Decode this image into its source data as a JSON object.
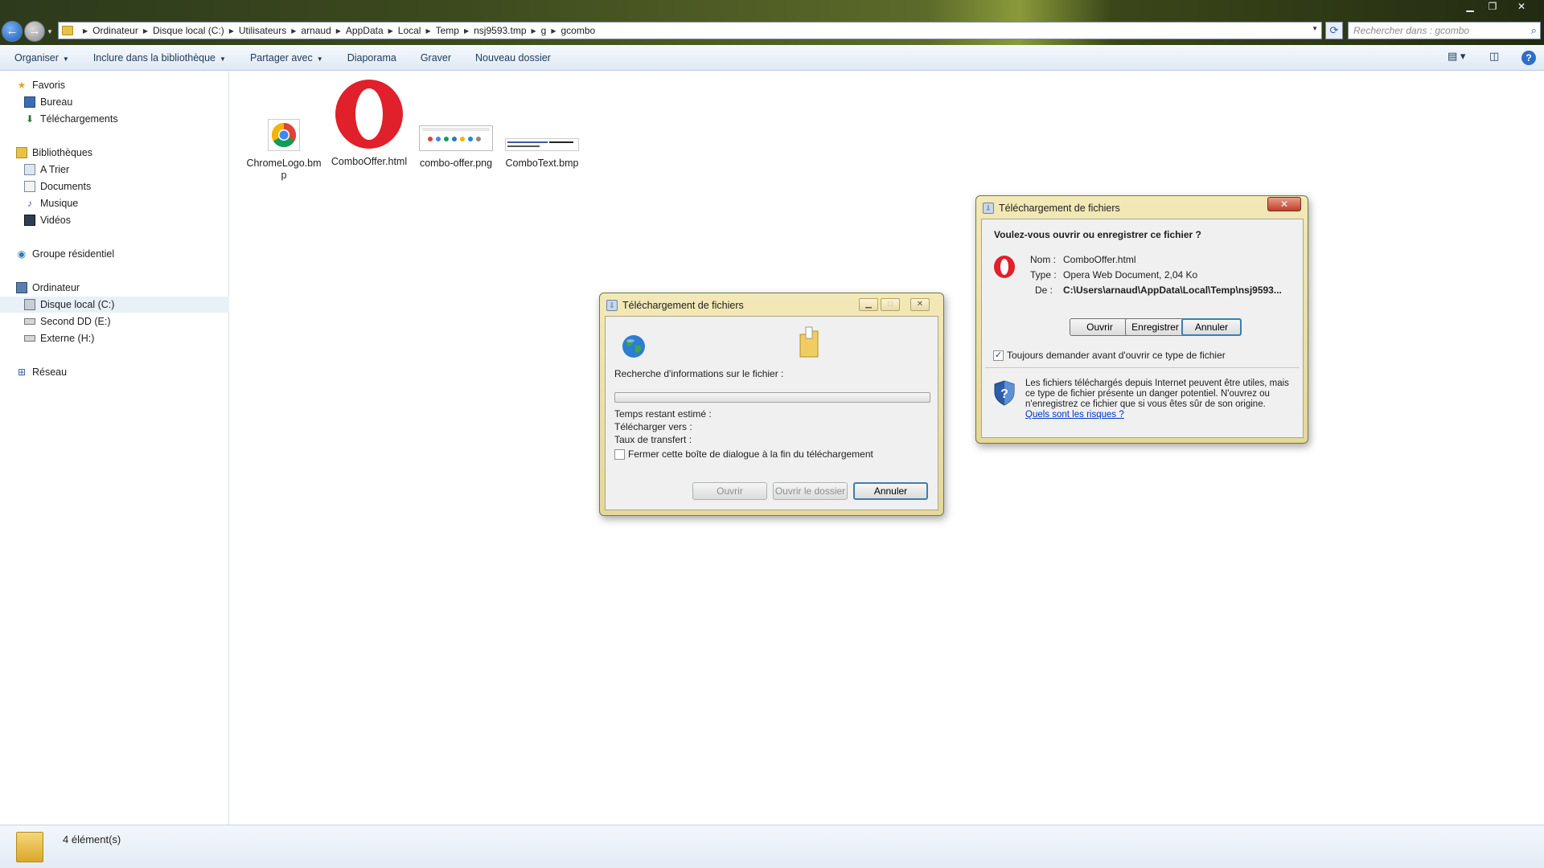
{
  "window": {
    "minimize": "▁",
    "maximize": "❐",
    "close": "✕"
  },
  "nav": {
    "back": "←",
    "forward": "→"
  },
  "address": {
    "crumbs": [
      "Ordinateur",
      "Disque local (C:)",
      "Utilisateurs",
      "arnaud",
      "AppData",
      "Local",
      "Temp",
      "nsj9593.tmp",
      "g",
      "gcombo"
    ]
  },
  "search": {
    "placeholder": "Rechercher dans : gcombo"
  },
  "toolbar": {
    "organize": "Organiser",
    "include": "Inclure dans la bibliothèque",
    "share": "Partager avec",
    "slideshow": "Diaporama",
    "burn": "Graver",
    "new_folder": "Nouveau dossier"
  },
  "sidebar": {
    "favorites": "Favoris",
    "desktop": "Bureau",
    "downloads": "Téléchargements",
    "libraries": "Bibliothèques",
    "atrier": "A Trier",
    "documents": "Documents",
    "music": "Musique",
    "videos": "Vidéos",
    "homegroup": "Groupe résidentiel",
    "computer": "Ordinateur",
    "local_disk": "Disque local (C:)",
    "second_dd": "Second DD (E:)",
    "external": "Externe (H:)",
    "network": "Réseau"
  },
  "files": [
    {
      "name": "ChromeLogo.bmp"
    },
    {
      "name": "ComboOffer.html"
    },
    {
      "name": "combo-offer.png"
    },
    {
      "name": "ComboText.bmp"
    }
  ],
  "status": {
    "count": "4 élément(s)"
  },
  "progress_dialog": {
    "title": "Téléchargement de fichiers",
    "searching": "Recherche d'informations sur le fichier :",
    "time_left": "Temps restant estimé :",
    "download_to": "Télécharger vers :",
    "transfer_rate": "Taux de transfert :",
    "close_when_done": "Fermer cette boîte de dialogue à la fin du téléchargement",
    "close_checked": false,
    "open": "Ouvrir",
    "open_folder": "Ouvrir le dossier",
    "cancel": "Annuler",
    "progress": 0
  },
  "open_save_dialog": {
    "title": "Téléchargement de fichiers",
    "question": "Voulez-vous ouvrir ou enregistrer ce fichier ?",
    "name_label": "Nom :",
    "name_value": "ComboOffer.html",
    "type_label": "Type :",
    "type_value": "Opera Web Document, 2,04 Ko",
    "from_label": "De :",
    "from_value": "C:\\Users\\arnaud\\AppData\\Local\\Temp\\nsj9593...",
    "open": "Ouvrir",
    "save": "Enregistrer",
    "cancel": "Annuler",
    "always_ask": "Toujours demander avant d'ouvrir ce type de fichier",
    "always_ask_checked": true,
    "warning": "Les fichiers téléchargés depuis Internet peuvent être utiles, mais ce type de fichier présente un danger potentiel. N'ouvrez ou n'enregistrez ce fichier que si vous êtes sûr de son origine.",
    "risks_link": "Quels sont les risques ?"
  },
  "colors": {
    "accent": "#1e395b",
    "dialog_frame": "#e6d79a",
    "opera_red": "#e0202a",
    "link": "#0033cc"
  }
}
